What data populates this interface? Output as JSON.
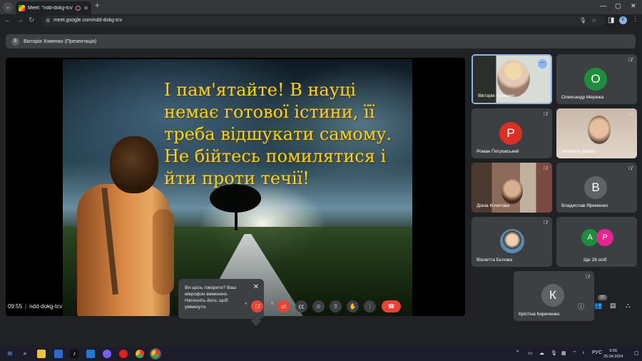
{
  "browser": {
    "tab_title": "Meet: \"ndd-dokg-tcv\"",
    "url": "meet.google.com/ndd-dokg-tcv",
    "profile_initial": "K",
    "new_tab_symbol": "+",
    "window_controls": [
      "—",
      "▢",
      "✕"
    ]
  },
  "meet": {
    "presenter_initial": "В",
    "presenter_label": "Вікторія Хоменко (Презентація)",
    "slide_lines": [
      "І пам'ятайте! В науці",
      "немає готової істини, її",
      "треба відшукати самому.",
      "Не бійтесь помилятися і",
      "йти проти течії!"
    ],
    "toast": {
      "text": "Ви щось говорите? Ваш мікрофон вимкнено. Натисніть його, щоб увімкнути.",
      "close_symbol": "✕"
    },
    "participants": [
      {
        "name": "Вікторія Хоменко",
        "type": "video",
        "active": true
      },
      {
        "name": "Олександр Мережа",
        "initial": "О",
        "color": "#1e8e3e"
      },
      {
        "name": "Роман Петровський",
        "initial": "Р",
        "color": "#d93025"
      },
      {
        "name": "Михайло Дикий",
        "type": "video"
      },
      {
        "name": "Діана Кочетова",
        "type": "video"
      },
      {
        "name": "Владислав Яременко",
        "initial": "В",
        "color": "#5f6368"
      },
      {
        "name": "Віолетта Бєлова",
        "type": "video"
      },
      {
        "name": "Ще 28 осіб",
        "avatars": [
          {
            "initial": "А",
            "color": "#1e8e3e"
          },
          {
            "initial": "Р",
            "color": "#e52592"
          }
        ]
      },
      {
        "name": "Крістіна Кириченко",
        "initial": "К",
        "color": "#5f6368"
      }
    ],
    "time": "09:55",
    "meeting_code": "ndd-dokg-tcv",
    "participant_count": "37"
  },
  "taskbar": {
    "language": "РУС",
    "time": "9:55",
    "date": "25.04.2024"
  },
  "colors": {
    "accent": "#8ab4f8",
    "danger": "#ea4335",
    "tile_bg": "#3c4043",
    "slide_text": "#f2d22a"
  }
}
